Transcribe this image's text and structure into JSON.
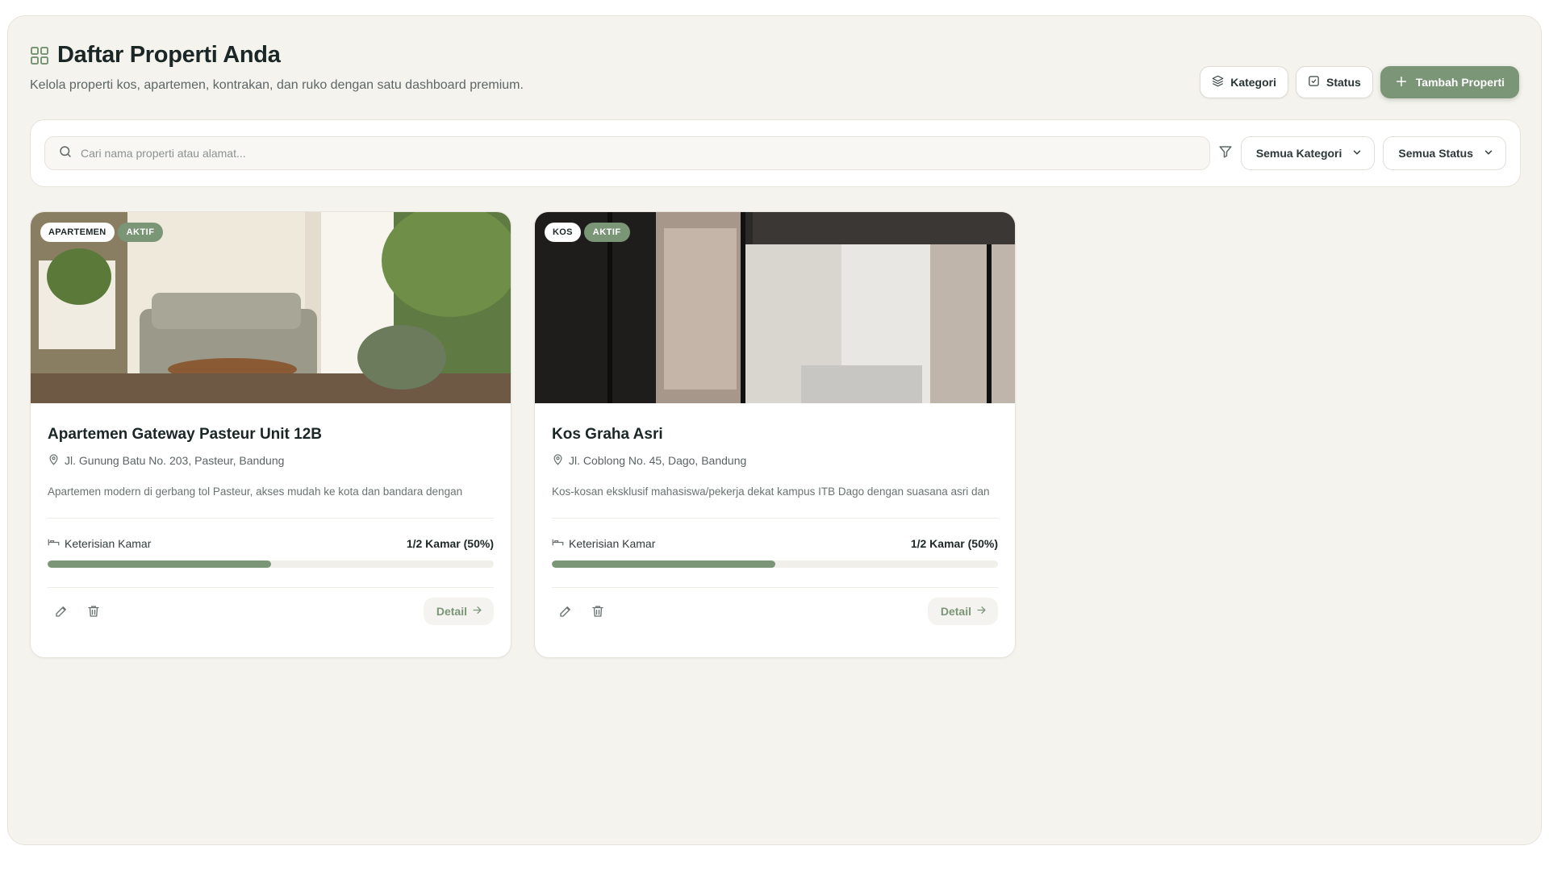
{
  "header": {
    "title": "Daftar Properti Anda",
    "subtitle": "Kelola properti kos, apartemen, kontrakan, dan ruko dengan satu dashboard premium.",
    "buttons": {
      "kategori": "Kategori",
      "status": "Status",
      "tambah": "Tambah Properti"
    }
  },
  "filters": {
    "search_placeholder": "Cari nama properti atau alamat...",
    "kategori_selected": "Semua Kategori",
    "status_selected": "Semua Status"
  },
  "colors": {
    "accent": "#7b9577",
    "background": "#f5f3ee"
  },
  "properties": [
    {
      "category": "APARTEMEN",
      "status": "AKTIF",
      "name": "Apartemen Gateway Pasteur Unit 12B",
      "address": "Jl. Gunung Batu No. 203, Pasteur, Bandung",
      "description": "Apartemen modern di gerbang tol Pasteur, akses mudah ke kota dan bandara dengan fasilitas privat.",
      "occupancy_label": "Keterisian Kamar",
      "occupancy_value": "1/2 Kamar (50%)",
      "occupancy_fraction": 0.5,
      "detail_label": "Detail"
    },
    {
      "category": "KOS",
      "status": "AKTIF",
      "name": "Kos Graha Asri",
      "address": "Jl. Coblong No. 45, Dago, Bandung",
      "description": "Kos-kosan eksklusif mahasiswa/pekerja dekat kampus ITB Dago dengan suasana asri dan tenang.",
      "occupancy_label": "Keterisian Kamar",
      "occupancy_value": "1/2 Kamar (50%)",
      "occupancy_fraction": 0.5,
      "detail_label": "Detail"
    }
  ]
}
